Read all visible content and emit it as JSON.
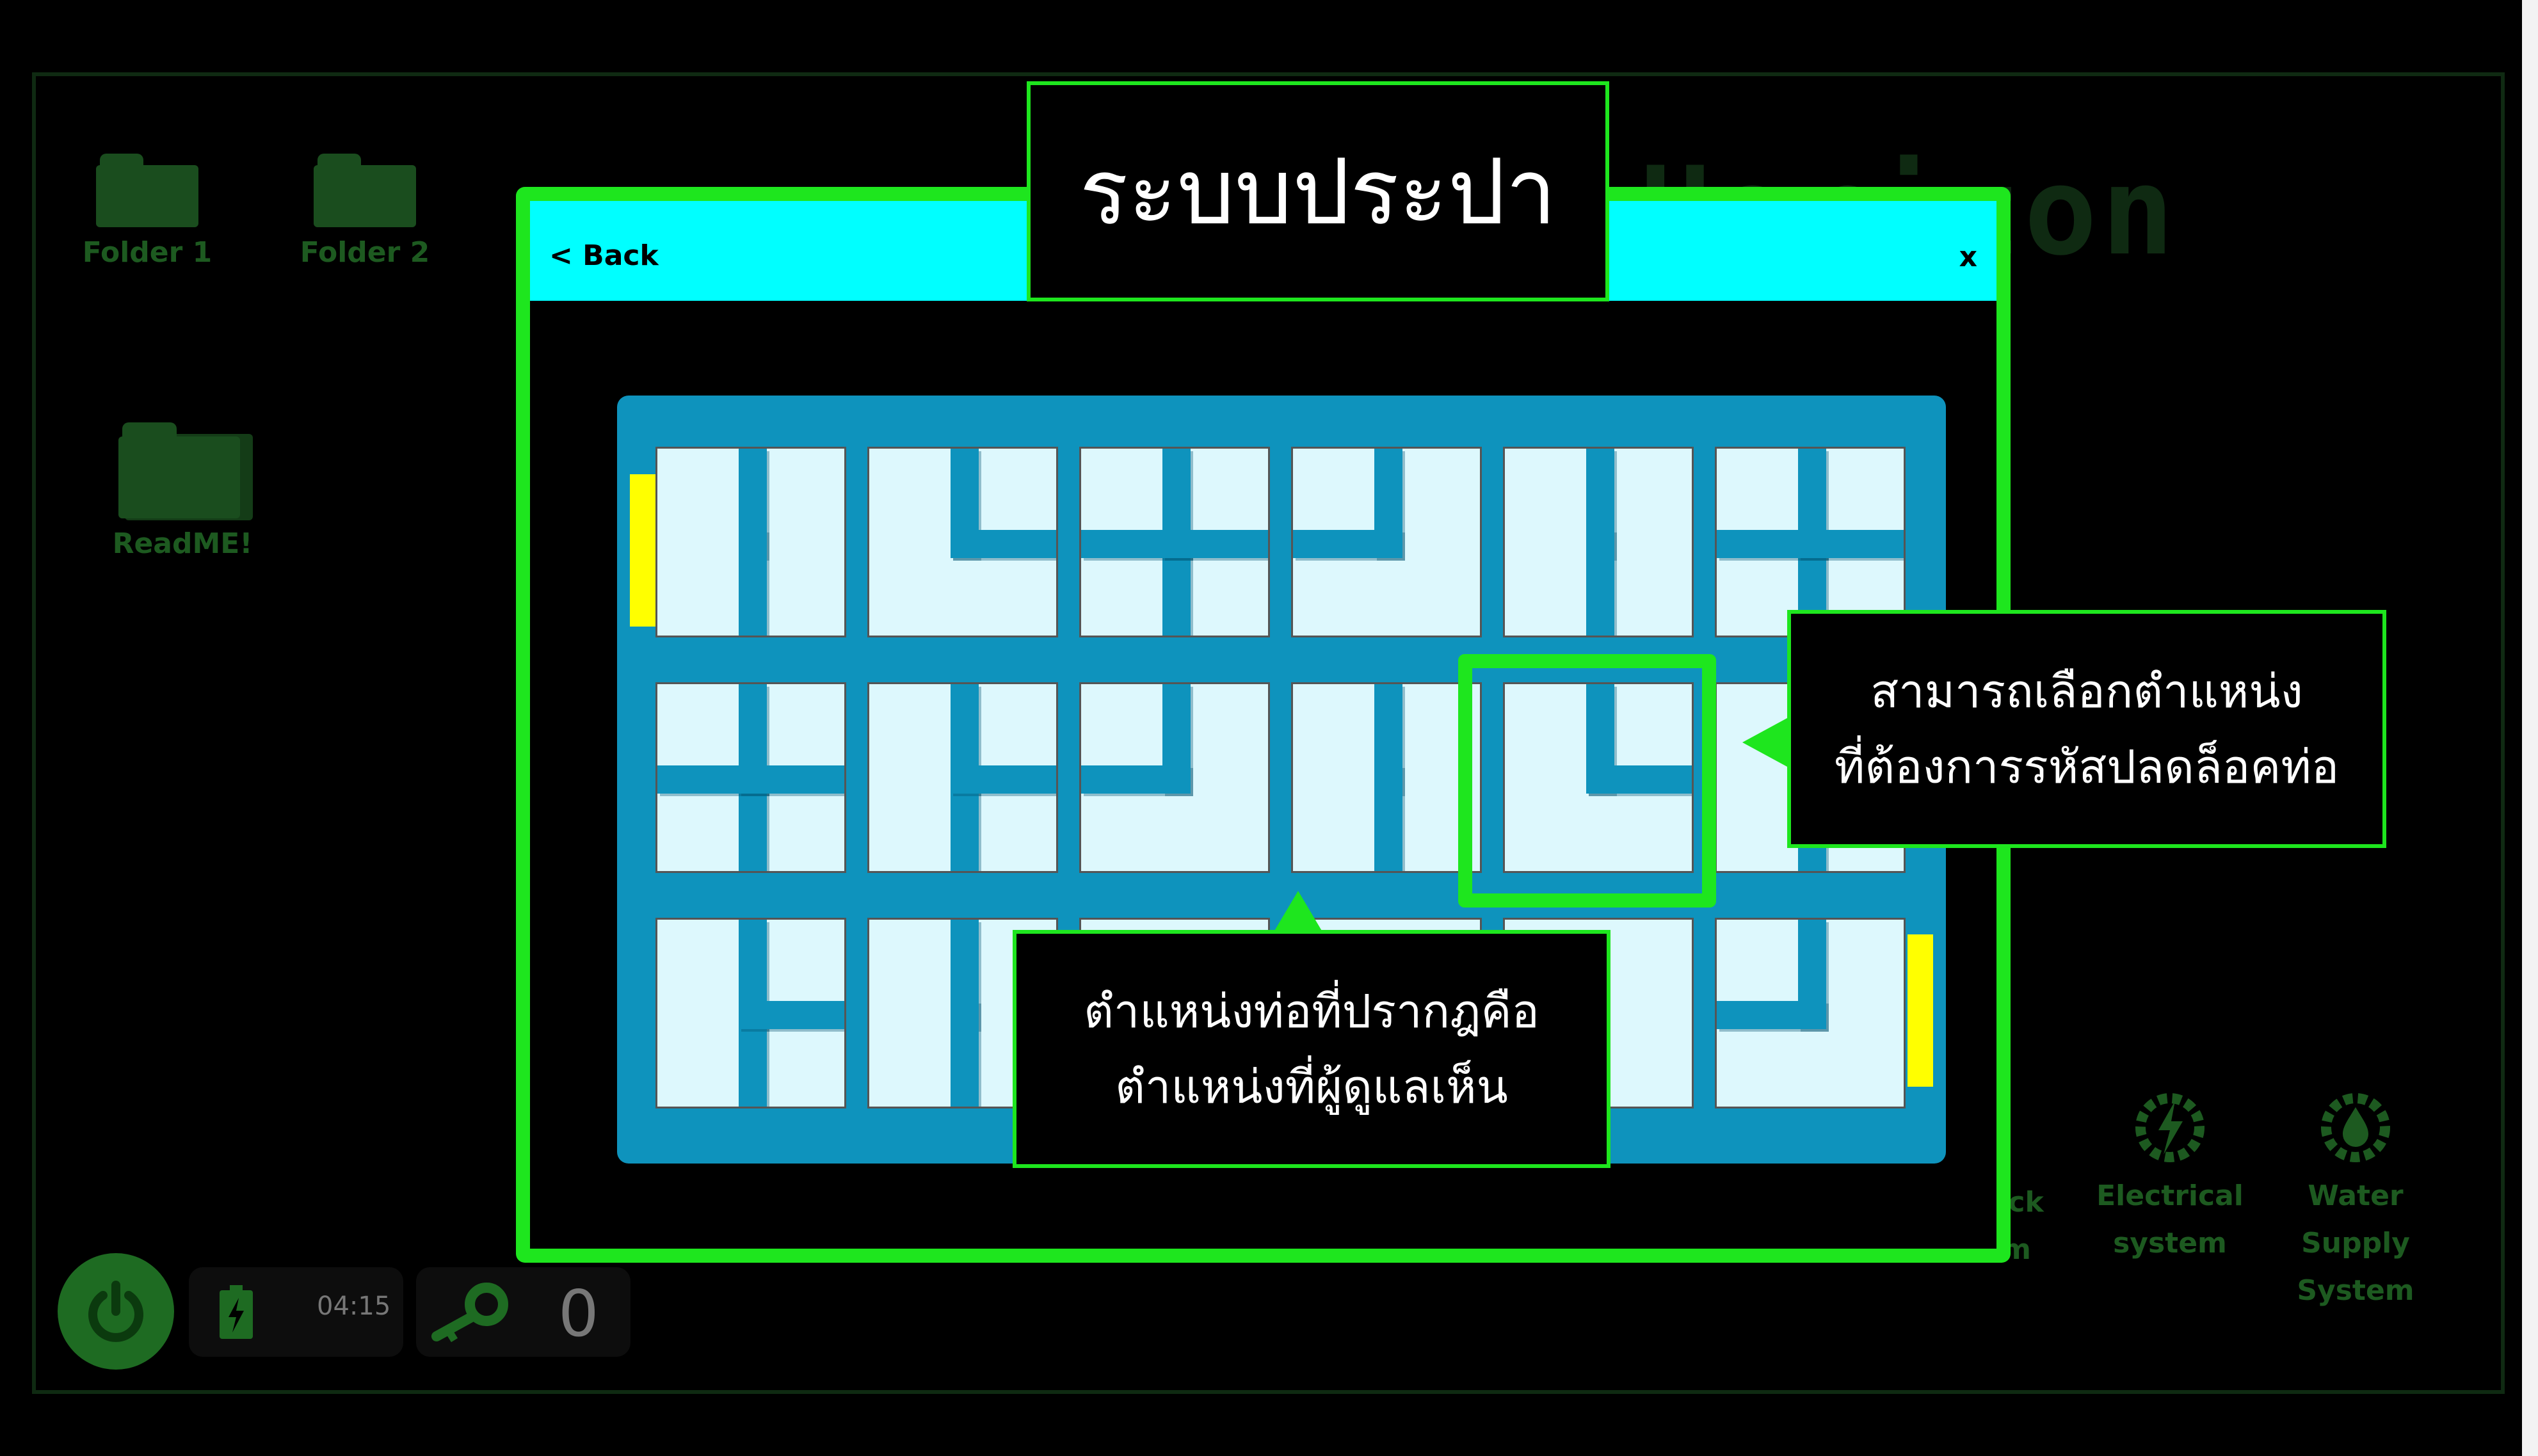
{
  "desktop": {
    "title": "Horizon",
    "icons": [
      {
        "label": "Folder 1",
        "icon": "folder-icon"
      },
      {
        "label": "Folder 2",
        "icon": "folder-icon"
      },
      {
        "label": "ReadME!",
        "icon": "folder-icon"
      }
    ],
    "systems": [
      {
        "line1": "ock",
        "line2": "m",
        "icon": "lock-icon"
      },
      {
        "line1": "Electrical",
        "line2": "system",
        "icon": "lightning-gear-icon"
      },
      {
        "line1": "Water",
        "line2": "Supply",
        "line3": "System",
        "icon": "water-drop-gear-icon"
      }
    ]
  },
  "taskbar": {
    "power_icon": "power-icon",
    "battery_icon": "battery-icon",
    "time": "04:15",
    "key_icon": "key-icon",
    "key_count": "0"
  },
  "window": {
    "title": "ระบบประปา",
    "back_label": "< Back",
    "close_label": "x",
    "header_color": "#00ffff",
    "border_color": "#1ee61e"
  },
  "puzzle": {
    "rows": 3,
    "cols": 6,
    "pipe_color": "#0e93bd",
    "tile_color": "#ddf8fd",
    "gate_color": "#ffff00",
    "tiles": [
      [
        "vertical",
        "corner-up-right",
        "cross",
        "corner-up-left",
        "vertical",
        "cross"
      ],
      [
        "cross",
        "tee-right",
        "corner-up-left",
        "vertical",
        "corner-up-right",
        "tee-partial"
      ],
      [
        "tee-right",
        "vertical",
        "hidden",
        "hidden",
        "hidden",
        "corner-up-left"
      ]
    ],
    "selected_tile": {
      "row": 2,
      "col": 5
    }
  },
  "callouts": {
    "right_line1": "สามารถเลือกตำแหน่ง",
    "right_line2": "ที่ต้องการรหัสปลดล็อคท่อ",
    "bottom_line1": "ตำแหน่งท่อที่ปรากฎคือ",
    "bottom_line2": "ตำแหน่งที่ผู้ดูแลเห็น"
  }
}
